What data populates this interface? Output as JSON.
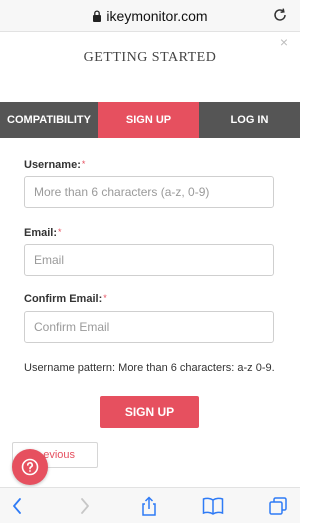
{
  "browser": {
    "url": "ikeymonitor.com"
  },
  "modal": {
    "close_label": "×",
    "title": "GETTING STARTED",
    "tabs": [
      {
        "label": "COMPATIBILITY",
        "active": false
      },
      {
        "label": "SIGN UP",
        "active": true
      },
      {
        "label": "LOG IN",
        "active": false
      }
    ],
    "form": {
      "username": {
        "label": "Username:",
        "required_mark": "*",
        "placeholder": "More than 6 characters (a-z, 0-9)",
        "value": ""
      },
      "email": {
        "label": "Email:",
        "required_mark": "*",
        "placeholder": "Email",
        "value": ""
      },
      "confirm_email": {
        "label": "Confirm Email:",
        "required_mark": "*",
        "placeholder": "Confirm Email",
        "value": ""
      },
      "hint": "Username pattern: More than 6 characters: a-z 0-9.",
      "submit_label": "SIGN UP"
    },
    "previous_label": "evious"
  },
  "help_button": {
    "icon": "question-icon"
  },
  "toolbar": {
    "icons": [
      "back-icon",
      "forward-icon",
      "share-icon",
      "bookmarks-icon",
      "tabs-icon"
    ]
  },
  "colors": {
    "accent": "#e6505f",
    "tab_inactive": "#555555",
    "toolbar_icon": "#2f7bf6"
  }
}
